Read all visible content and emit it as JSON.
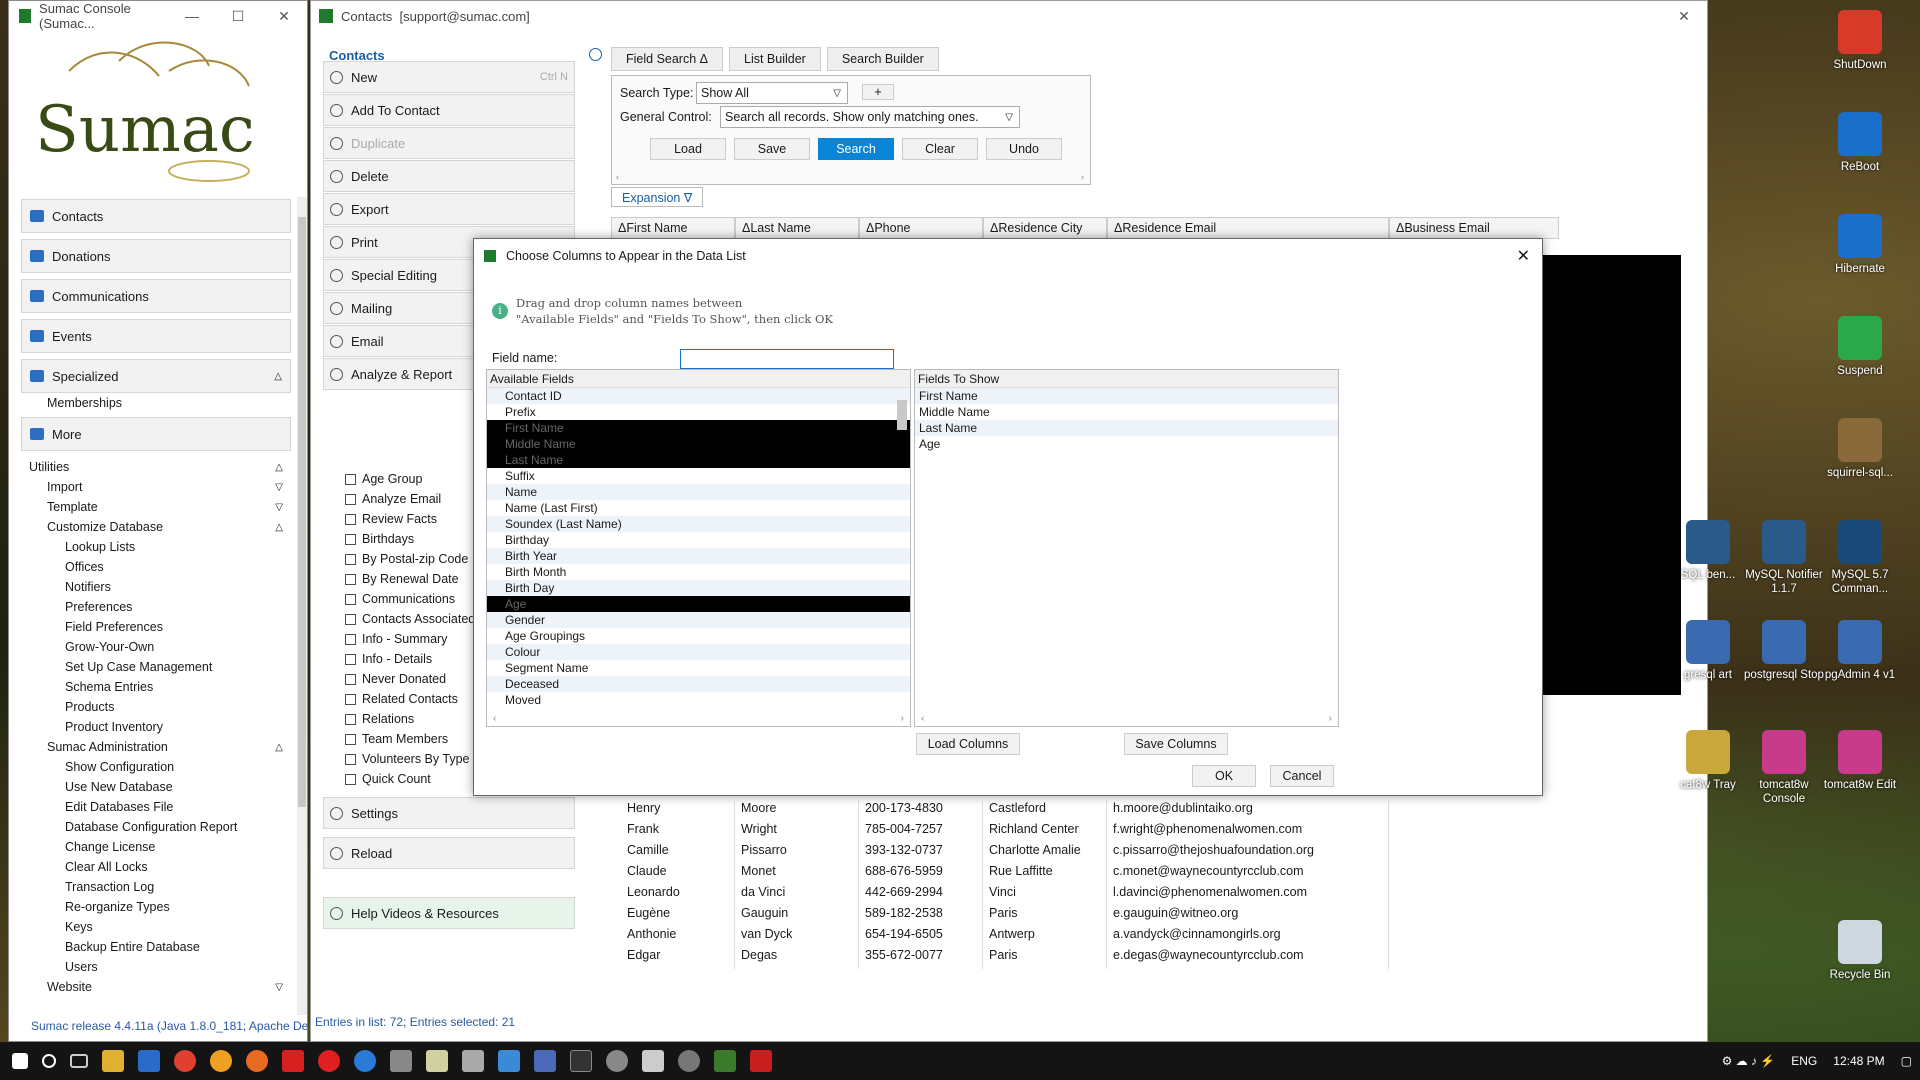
{
  "console": {
    "title": "Sumac Console (Sumac...",
    "logo_text": "Sumac",
    "status": "Sumac release 4.4.11a (Java 1.8.0_181; Apache Der",
    "nav": [
      {
        "label": "Contacts"
      },
      {
        "label": "Donations"
      },
      {
        "label": "Communications"
      },
      {
        "label": "Events"
      }
    ],
    "specialized": "Specialized",
    "memberships": "Memberships",
    "more": "More",
    "utilities": "Utilities",
    "util_items": [
      {
        "label": "Import",
        "chev": "▽"
      },
      {
        "label": "Template",
        "chev": "▽"
      },
      {
        "label": "Customize Database",
        "chev": "△"
      }
    ],
    "customize_items": [
      "Lookup Lists",
      "Offices",
      "Notifiers",
      "Preferences",
      "Field Preferences",
      "Grow-Your-Own",
      "Set Up Case Management",
      "Schema Entries",
      "Products",
      "Product Inventory"
    ],
    "sumac_admin": "Sumac Administration",
    "admin_items": [
      "Show Configuration",
      "Use New Database",
      "Edit Databases File",
      "Database Configuration Report",
      "Change License",
      "Clear All Locks",
      "Transaction Log",
      "Re-organize Types",
      "Keys",
      "Backup Entire Database",
      "Users"
    ],
    "website": "Website"
  },
  "contacts": {
    "title": "Contacts",
    "account": "[support@sumac.com]",
    "heading": "Contacts",
    "actions": [
      {
        "label": "New",
        "shortcut": "Ctrl N"
      },
      {
        "label": "Add To Contact",
        "shortcut": ""
      },
      {
        "label": "Duplicate",
        "shortcut": ""
      },
      {
        "label": "Delete",
        "shortcut": ""
      },
      {
        "label": "Export",
        "shortcut": ""
      },
      {
        "label": "Print",
        "shortcut": ""
      },
      {
        "label": "Special Editing",
        "shortcut": ""
      },
      {
        "label": "Mailing",
        "shortcut": ""
      },
      {
        "label": "Email",
        "shortcut": ""
      },
      {
        "label": "Analyze & Report",
        "shortcut": ""
      }
    ],
    "reports": [
      "Age Group",
      "Analyze Email",
      "Review Facts",
      "Birthdays",
      "By Postal-zip Code",
      "By Renewal Date",
      "Communications",
      "Contacts Associated",
      "Info - Summary",
      "Info - Details",
      "Never Donated",
      "Related Contacts",
      "Relations",
      "Team Members",
      "Volunteers By Type",
      "Quick Count"
    ],
    "settings": "Settings",
    "reload": "Reload",
    "help": "Help Videos & Resources",
    "tabs": [
      "Field Search Δ",
      "List Builder",
      "Search Builder"
    ],
    "search_type_label": "Search Type:",
    "search_type": "Show All",
    "plus": "+",
    "general_control_label": "General Control:",
    "general_control": "Search all records. Show only matching ones.",
    "buttons": [
      "Load",
      "Save",
      "Search",
      "Clear",
      "Undo"
    ],
    "expansion": "Expansion ∇",
    "columns": [
      "ΔFirst Name",
      "ΔLast Name",
      "ΔPhone",
      "ΔResidence City",
      "ΔResidence Email",
      "ΔBusiness Email"
    ],
    "rows": [
      [
        "Henry",
        "Moore",
        "200-173-4830",
        "Castleford",
        "h.moore@dublintaiko.org"
      ],
      [
        "Frank",
        "Wright",
        "785-004-7257",
        "Richland Center",
        "f.wright@phenomenalwomen.com"
      ],
      [
        "Camille",
        "Pissarro",
        "393-132-0737",
        "Charlotte Amalie",
        "c.pissarro@thejoshuafoundation.org"
      ],
      [
        "Claude",
        "Monet",
        "688-676-5959",
        "Rue Laffitte",
        "c.monet@waynecountyrcclub.com"
      ],
      [
        "Leonardo",
        "da Vinci",
        "442-669-2994",
        "Vinci",
        "l.davinci@phenomenalwomen.com"
      ],
      [
        "Eugène",
        "Gauguin",
        "589-182-2538",
        "Paris",
        "e.gauguin@witneo.org"
      ],
      [
        "Anthonie",
        "van Dyck",
        "654-194-6505",
        "Antwerp",
        "a.vandyck@cinnamongirls.org"
      ],
      [
        "Edgar",
        "Degas",
        "355-672-0077",
        "Paris",
        "e.degas@waynecountyrcclub.com"
      ]
    ],
    "status": "Entries in list: 72; Entries selected: 21"
  },
  "dialog": {
    "title": "Choose Columns to Appear in the Data List",
    "info1": "Drag and drop column names between",
    "info2": "\"Available Fields\" and \"Fields To Show\", then click OK",
    "field_name_label": "Field name:",
    "field_name_value": "",
    "available_header": "Available Fields",
    "show_header": "Fields To Show",
    "available": [
      "Contact ID",
      "Prefix",
      "First Name",
      "Middle Name",
      "Last Name",
      "Suffix",
      "Name",
      "Name (Last First)",
      "Soundex (Last Name)",
      "Birthday",
      "Birth Year",
      "Birth Month",
      "Birth Day",
      "Age",
      "Gender",
      "Age Groupings",
      "Colour",
      "Segment Name",
      "Deceased",
      "Moved"
    ],
    "selected_available": [
      "First Name",
      "Middle Name",
      "Last Name",
      "Age"
    ],
    "show": [
      "First Name",
      "Middle Name",
      "Last Name",
      "Age"
    ],
    "load_columns": "Load Columns",
    "save_columns": "Save Columns",
    "ok": "OK",
    "cancel": "Cancel"
  },
  "desktop": [
    {
      "label": "ShutDown",
      "color": "#d83a2a"
    },
    {
      "label": "ReBoot",
      "color": "#1a6fc8"
    },
    {
      "label": "Hibernate",
      "color": "#1a6fc8"
    },
    {
      "label": "Suspend",
      "color": "#2aa84a"
    },
    {
      "label": "squirrel-sql...",
      "color": "#8a6a3a"
    },
    {
      "label": "MySQL 5.7 Comman...",
      "color": "#1a4a7a"
    },
    {
      "label": "MySQL Notifier 1.1.7",
      "color": "#2a5a8a"
    },
    {
      "label": "SQL ben...",
      "color": "#2a5a8a"
    },
    {
      "label": "pgAdmin 4 v1",
      "color": "#3a6ab0"
    },
    {
      "label": "postgresql Stop",
      "color": "#3a6ab0"
    },
    {
      "label": "gresql art",
      "color": "#3a6ab0"
    },
    {
      "label": "tomcat8w Edit",
      "color": "#c83a8a"
    },
    {
      "label": "tomcat8w Console",
      "color": "#c83a8a"
    },
    {
      "label": "cat8w Tray",
      "color": "#c8a83a"
    },
    {
      "label": "Recycle Bin",
      "color": "#cfd8e0"
    }
  ],
  "taskbar": {
    "lang": "ENG",
    "time": "12:48 PM"
  }
}
